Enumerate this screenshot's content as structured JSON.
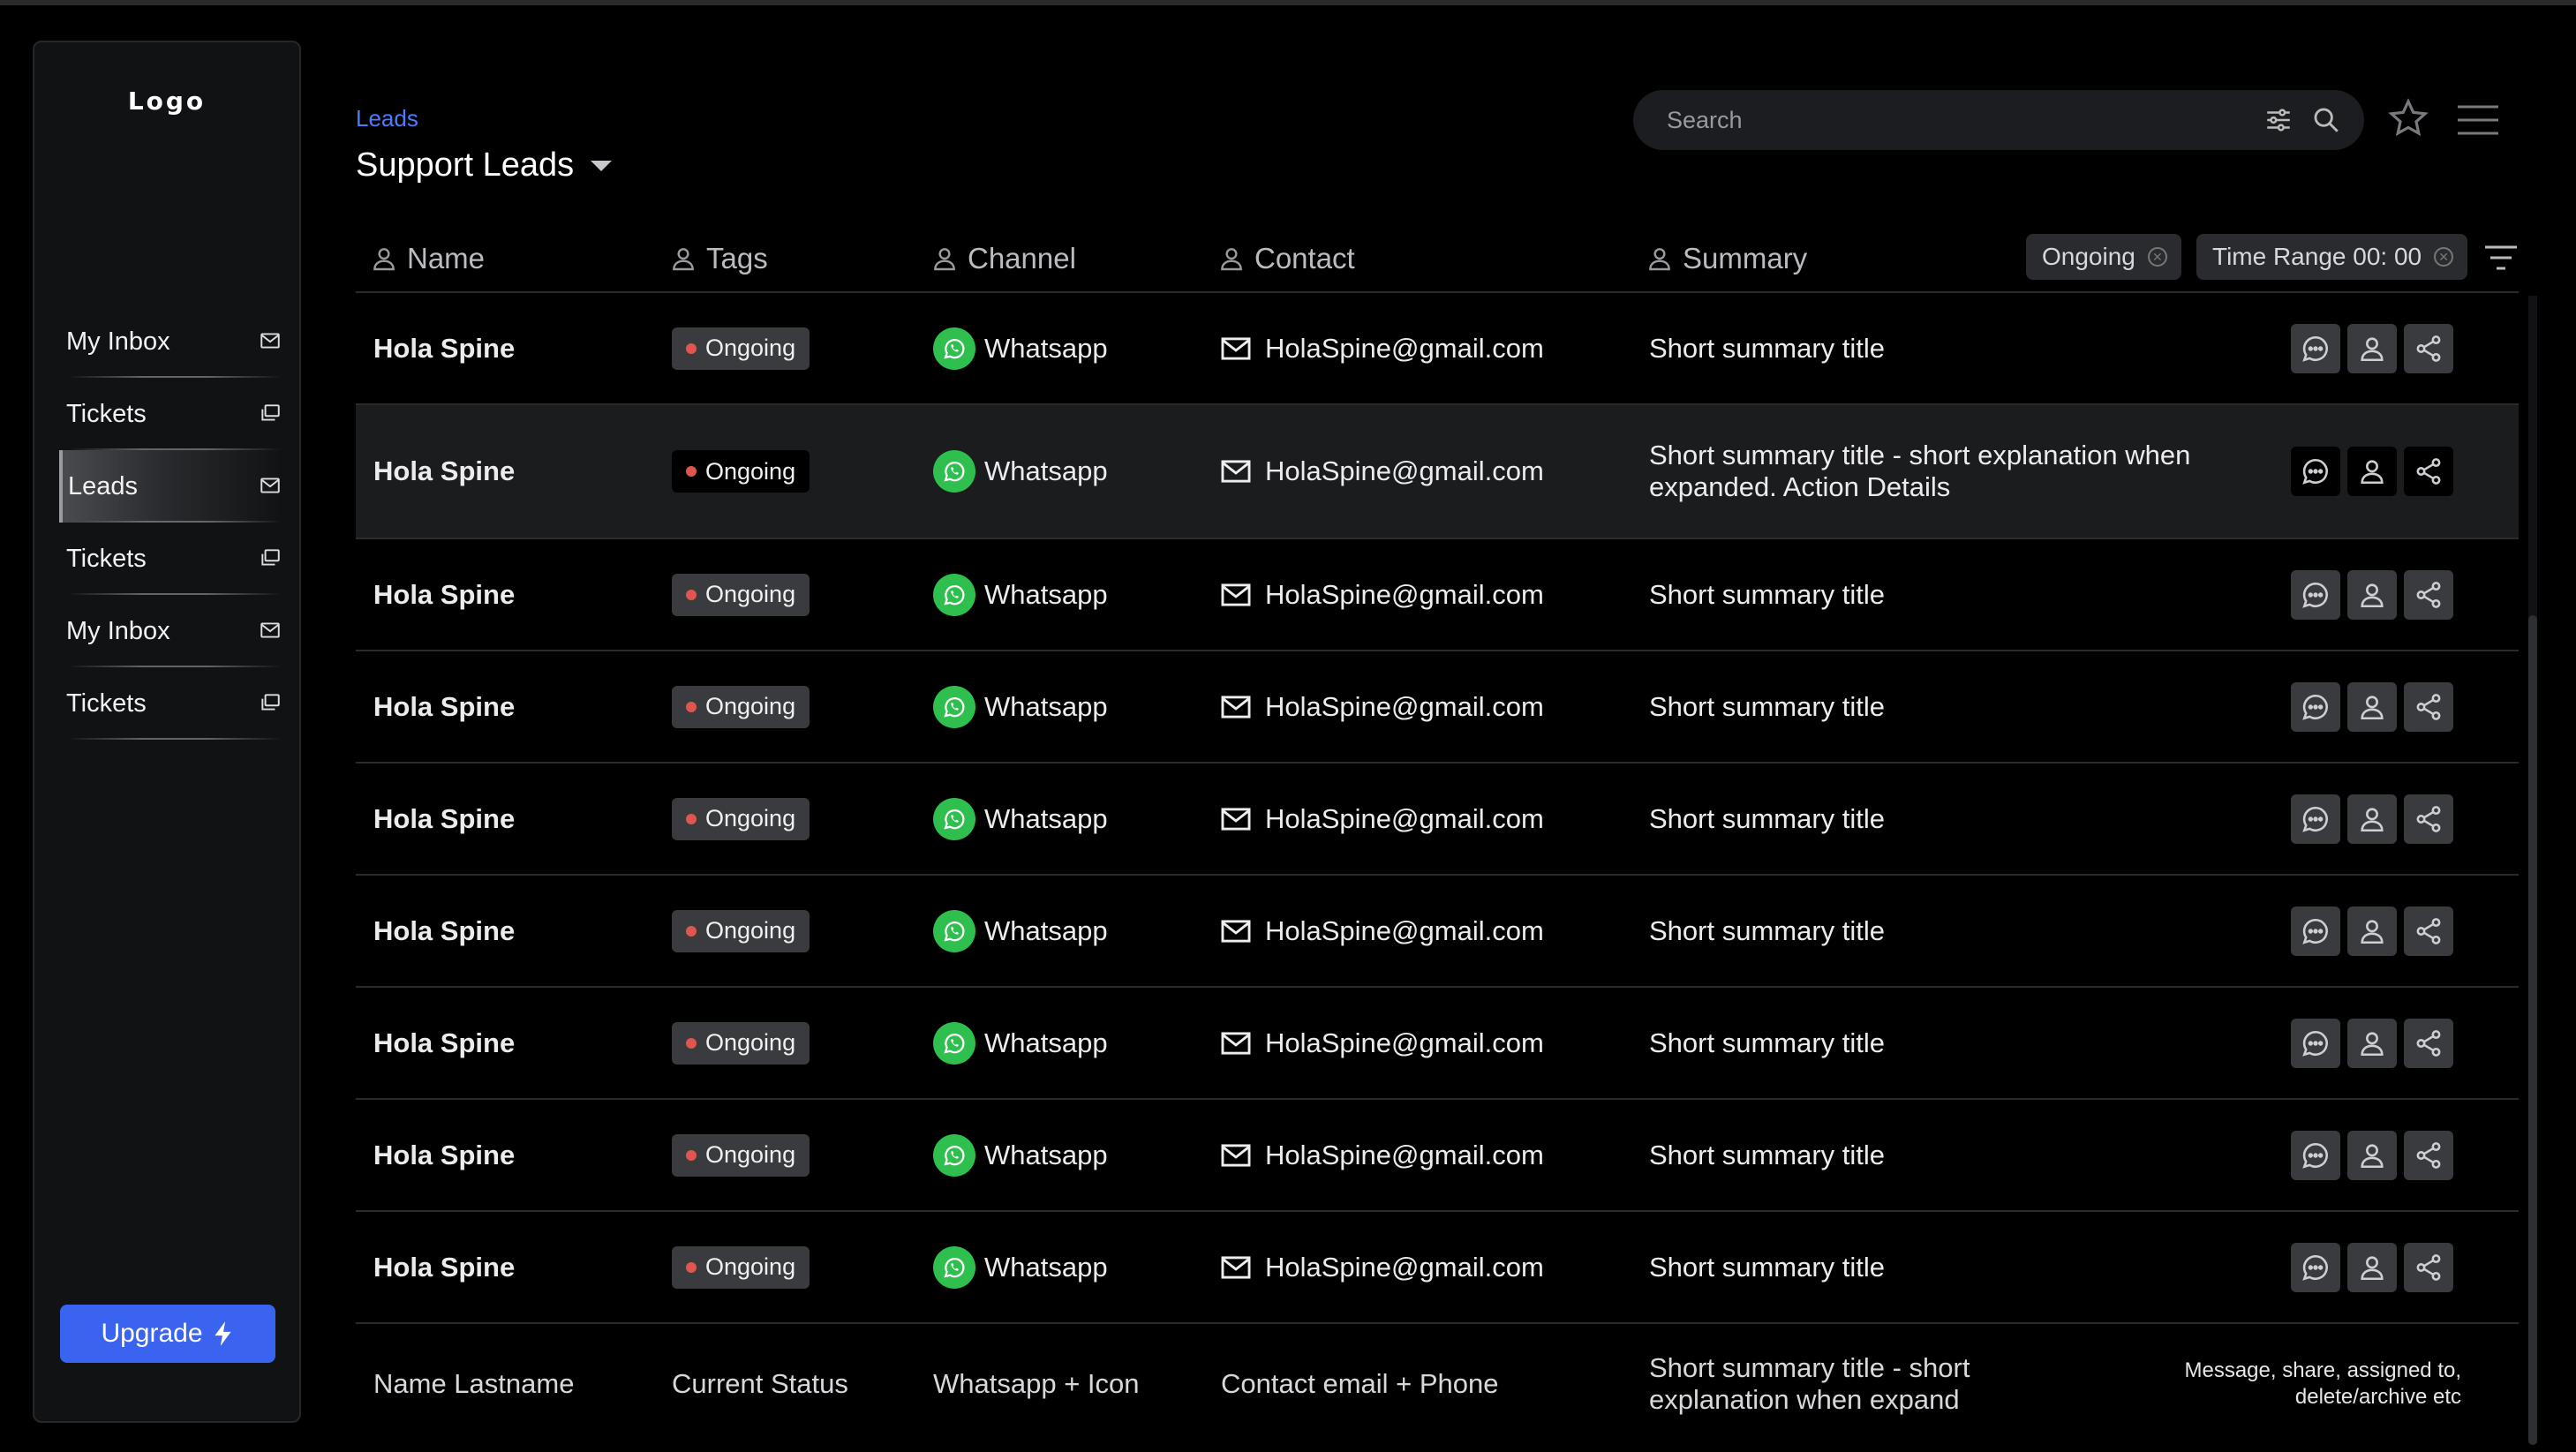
{
  "logo": "Logo",
  "sidebar": {
    "items": [
      {
        "label": "My Inbox",
        "icon": "mail-icon"
      },
      {
        "label": "Tickets",
        "icon": "folders-icon"
      },
      {
        "label": "Leads",
        "icon": "mail-icon",
        "active": true
      },
      {
        "label": "Tickets",
        "icon": "folders-icon"
      },
      {
        "label": "My Inbox",
        "icon": "mail-icon"
      },
      {
        "label": "Tickets",
        "icon": "folders-icon"
      }
    ],
    "upgrade_label": "Upgrade"
  },
  "header": {
    "breadcrumb": "Leads",
    "title": "Support Leads",
    "search_placeholder": "Search"
  },
  "table": {
    "columns": [
      "Name",
      "Tags",
      "Channel",
      "Contact",
      "Summary"
    ],
    "filters": [
      "Ongoing",
      "Time Range 00: 00"
    ],
    "rows": [
      {
        "name": "Hola Spine",
        "tag": "Ongoing",
        "channel": "Whatsapp",
        "contact": "HolaSpine@gmail.com",
        "summary": "Short summary title"
      },
      {
        "name": "Hola Spine",
        "tag": "Ongoing",
        "channel": "Whatsapp",
        "contact": "HolaSpine@gmail.com",
        "summary": "Short summary title - short explanation when expanded. Action Details",
        "expanded": true
      },
      {
        "name": "Hola Spine",
        "tag": "Ongoing",
        "channel": "Whatsapp",
        "contact": "HolaSpine@gmail.com",
        "summary": "Short summary title"
      },
      {
        "name": "Hola Spine",
        "tag": "Ongoing",
        "channel": "Whatsapp",
        "contact": "HolaSpine@gmail.com",
        "summary": "Short summary title"
      },
      {
        "name": "Hola Spine",
        "tag": "Ongoing",
        "channel": "Whatsapp",
        "contact": "HolaSpine@gmail.com",
        "summary": "Short summary title"
      },
      {
        "name": "Hola Spine",
        "tag": "Ongoing",
        "channel": "Whatsapp",
        "contact": "HolaSpine@gmail.com",
        "summary": "Short summary title"
      },
      {
        "name": "Hola Spine",
        "tag": "Ongoing",
        "channel": "Whatsapp",
        "contact": "HolaSpine@gmail.com",
        "summary": "Short summary title"
      },
      {
        "name": "Hola Spine",
        "tag": "Ongoing",
        "channel": "Whatsapp",
        "contact": "HolaSpine@gmail.com",
        "summary": "Short summary title"
      },
      {
        "name": "Hola Spine",
        "tag": "Ongoing",
        "channel": "Whatsapp",
        "contact": "HolaSpine@gmail.com",
        "summary": "Short summary title"
      }
    ],
    "footer": {
      "name": "Name Lastname",
      "tag": "Current Status",
      "channel": "Whatsapp + Icon",
      "contact": "Contact email + Phone",
      "summary": "Short summary title - short explanation when expand",
      "actions": "Message, share, assigned to, delete/archive etc"
    }
  },
  "colors": {
    "accent": "#3a63f0",
    "breadcrumb": "#4d7bff",
    "whatsapp": "#2fbf4f",
    "status_dot": "#e0564e",
    "background": "#000000"
  }
}
